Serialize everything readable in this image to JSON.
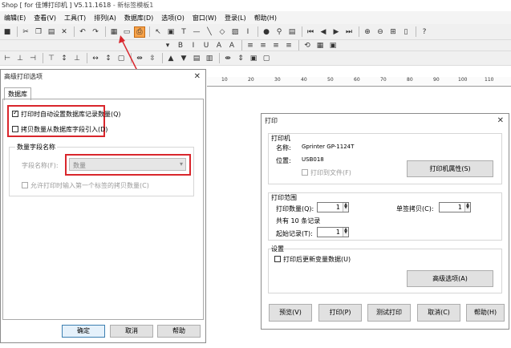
{
  "app": {
    "title": "Shop [ for 佳博打印机 ] V5.11.1618",
    "subtitle": "- 新标签模板1"
  },
  "menu": [
    "编辑(E)",
    "查看(V)",
    "工具(T)",
    "排列(A)",
    "数据库(D)",
    "选项(O)",
    "窗口(W)",
    "登录(L)",
    "帮助(H)"
  ],
  "ruler": [
    "10",
    "20",
    "30",
    "40",
    "50",
    "60",
    "70",
    "80",
    "90",
    "100",
    "110"
  ],
  "adv": {
    "title": "高级打印选项",
    "tab": "数据库",
    "cb_auto": "打印时自动设置数据库记录数量(Q)",
    "cb_copy": "拷贝数量从数据库字段引入(D)",
    "group_label": "数量字段名称",
    "field_label": "字段名称(F):",
    "field_value": "数量",
    "cb_prompt": "允许打印时输入第一个标签的拷贝数量(C)",
    "ok": "确定",
    "cancel": "取消",
    "help": "帮助"
  },
  "print": {
    "title": "打印",
    "printer_group": "打印机",
    "name_label": "名称:",
    "name_value": "Gprinter  GP-1124T",
    "loc_label": "位置:",
    "loc_value": "USB018",
    "print_to_file": "打印到文件(F)",
    "printer_props": "打印机属性(S)",
    "range_group": "打印范围",
    "qty_label": "打印数量(Q):",
    "qty_value": "1",
    "copies_label": "单签拷贝(C):",
    "copies_value": "1",
    "total": "共有 10 条记录",
    "start_label": "起始记录(T):",
    "start_value": "1",
    "settings_group": "设置",
    "update_vars": "打印后更新变量数据(U)",
    "advanced": "高级选项(A)",
    "preview": "预览(V)",
    "print_btn": "打印(P)",
    "test_print": "测试打印",
    "cancel": "取消(C)",
    "help": "帮助(H)"
  }
}
